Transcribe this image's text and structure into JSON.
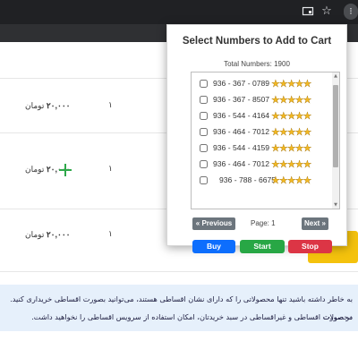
{
  "popup": {
    "title": "Select Numbers to Add to Cart",
    "total_label": "Total Numbers: 1900",
    "items": [
      {
        "number": "936 - 367 - 0789",
        "stars": "★★★★★"
      },
      {
        "number": "936 - 367 - 8507",
        "stars": "★★★★★"
      },
      {
        "number": "936 - 544 - 4164",
        "stars": "★★★★★"
      },
      {
        "number": "936 - 464 - 7012",
        "stars": "★★★★★"
      },
      {
        "number": "936 - 544 - 4159",
        "stars": "★★★★★"
      },
      {
        "number": "936 - 464 - 7012",
        "stars": "★★★★★"
      },
      {
        "number": "936 - 788 - 6675",
        "stars": "★★★★★"
      }
    ],
    "prev_label": "« Previous",
    "page_label": "Page: 1",
    "next_label": "Next »",
    "buy_label": "Buy",
    "start_label": "Start",
    "stop_label": "Stop",
    "colors": {
      "buy": "#0d6efd",
      "start": "#28a745",
      "stop": "#dc3545",
      "nav": "#6c757d"
    }
  },
  "page": {
    "rows": [
      {
        "price": "۲۰,۰۰۰",
        "currency": "تومان",
        "qty": "۱"
      },
      {
        "price": "۲۰,۰۰۰",
        "currency": "تومان",
        "qty": "۱"
      },
      {
        "price": "۲۰,۰۰۰",
        "currency": "تومان",
        "qty": "۱"
      }
    ],
    "notice_line1": "به خاطر داشته باشید تنها محصولاتی را که دارای نشان اقساطی هستند، می‌توانید بصورت اقساطی خریداری کنید. در صورت",
    "notice_line2": "محصولات اقساطی و غیراقساطی در سبد خریدتان، امکان استفاده از سرویس اقساطی را نخواهید داشت."
  },
  "chrome": {
    "icons": [
      "cast-icon",
      "star-icon",
      "extension-icon"
    ]
  }
}
